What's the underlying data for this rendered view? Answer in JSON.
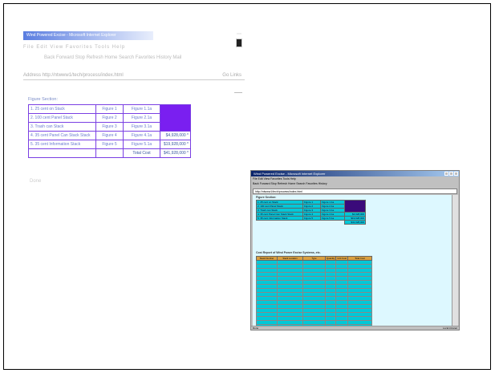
{
  "window1": {
    "title": "Wind Powered Excise - Microsoft Internet Explorer",
    "menu": "File  Edit  View  Favorites  Tools  Help",
    "toolbar": "Back  Forward  Stop  Refresh  Home  Search  Favorites  History  Mail",
    "address_label": "Address",
    "address_value": "http://ntwww1/tech/process/index.html",
    "go_label": "Go",
    "links_label": "Links",
    "section_title": "Figure Section:",
    "rows": [
      {
        "name": "1. 25 cent on Stack",
        "col2": "Figure 1",
        "col3": "Figure 1.1a",
        "value": ""
      },
      {
        "name": "2. 100 cent Panel Stack",
        "col2": "Figure 2",
        "col3": "Figure 2.1a",
        "value": ""
      },
      {
        "name": "3. Trash can Stack",
        "col2": "Figure 3",
        "col3": "Figure 3.1a",
        "value": ""
      },
      {
        "name": "4. 35 cent Panel Can Stack Stack",
        "col2": "Figure 4",
        "col3": "Figure 4.1a",
        "value": "$4,928,000 *"
      },
      {
        "name": "5. 35 cent Information Stack",
        "col2": "Figure 5",
        "col3": "Figure 5.1a",
        "value": "$19,928,000 *"
      }
    ],
    "total_label": "Total Cost",
    "total_value": "$41,928,000 *",
    "footer": "Done"
  },
  "window2": {
    "title": "Wind Powered Excise - Microsoft Internet Explorer",
    "menu": "File  Edit  View  Favorites  Tools  Help",
    "toolbar": "Back  Forward  Stop  Refresh  Home  Search  Favorites  History",
    "address": "http://ntwww1/tech/process/index.html",
    "section1_title": "Figure Section:",
    "rows": [
      {
        "name": "1. 25 cent on Stack",
        "b": "Figure 1",
        "c": "Figure 1.1a",
        "d": ""
      },
      {
        "name": "2. 100 cent Panel Stack",
        "b": "Figure 2",
        "c": "Figure 2.1a",
        "d": ""
      },
      {
        "name": "3. Trash can Stack",
        "b": "Figure 3",
        "c": "Figure 3.1a",
        "d": ""
      },
      {
        "name": "4. 35 cent Panel Can Stack Stack",
        "b": "Figure 4",
        "c": "Figure 4.1a",
        "d": "$4,928,000"
      },
      {
        "name": "5. 35 cent Information Stack",
        "b": "Figure 5",
        "c": "Figure 5.1a",
        "d": "$19,928,000"
      }
    ],
    "total_value": "$41,928,000",
    "section2_title": "Cost Report of Wind Power Excise Systems, etc.",
    "headers": [
      "Stack Number",
      "Stack Location",
      "Type",
      "Quantity",
      "Unit Cost",
      "Total Cost"
    ],
    "status_left": "Done",
    "status_right": "Local intranet"
  }
}
